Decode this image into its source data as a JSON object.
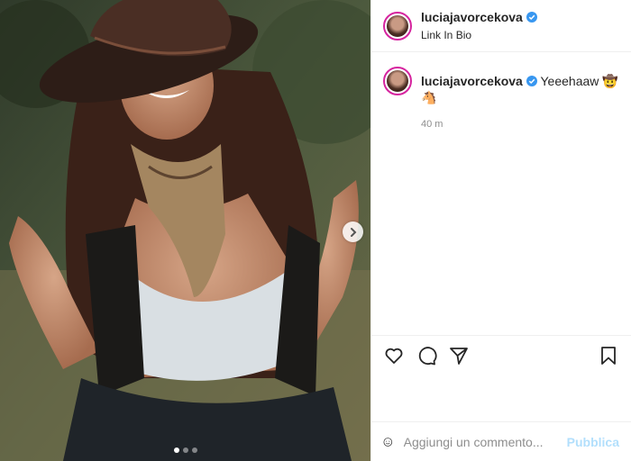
{
  "header": {
    "username": "luciajavorcekova",
    "subtitle": "Link In Bio"
  },
  "caption": {
    "username": "luciajavorcekova",
    "text": "Yeeehaaw 🤠🐴",
    "time": "40 m"
  },
  "comment_box": {
    "placeholder": "Aggiungi un commento...",
    "post_label": "Pubblica"
  },
  "carousel": {
    "current_index": 1,
    "total": 3
  },
  "colors": {
    "verified": "#3897f0",
    "post_disabled": "#b2dffc",
    "avatar_ring": "#d6249f"
  },
  "icons": [
    "chevron-right-icon",
    "verified-badge-icon",
    "heart-icon",
    "comment-icon",
    "share-icon",
    "bookmark-icon",
    "emoji-icon"
  ]
}
